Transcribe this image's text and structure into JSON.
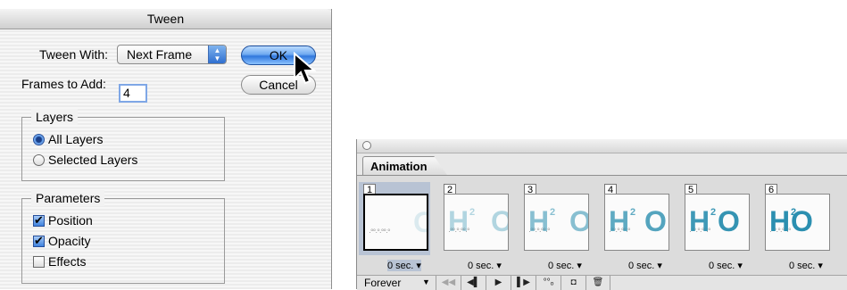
{
  "dialog": {
    "title": "Tween",
    "tween_with_label": "Tween With:",
    "tween_with_value": "Next Frame",
    "frames_to_add_label": "Frames to Add:",
    "frames_to_add_value": "4",
    "ok_label": "OK",
    "cancel_label": "Cancel",
    "layers_group": {
      "title": "Layers",
      "options": [
        {
          "label": "All Layers",
          "selected": true
        },
        {
          "label": "Selected Layers",
          "selected": false
        }
      ]
    },
    "parameters_group": {
      "title": "Parameters",
      "options": [
        {
          "label": "Position",
          "checked": true
        },
        {
          "label": "Opacity",
          "checked": true
        },
        {
          "label": "Effects",
          "checked": false
        }
      ]
    }
  },
  "palette": {
    "tab": "Animation",
    "frames": [
      {
        "number": "1",
        "delay": "0 sec.",
        "selected": true
      },
      {
        "number": "2",
        "delay": "0 sec.",
        "selected": false
      },
      {
        "number": "3",
        "delay": "0 sec.",
        "selected": false
      },
      {
        "number": "4",
        "delay": "0 sec.",
        "selected": false
      },
      {
        "number": "5",
        "delay": "0 sec.",
        "selected": false
      },
      {
        "number": "6",
        "delay": "0 sec.",
        "selected": false
      }
    ],
    "loop": "Forever",
    "thumb_text": {
      "h": "H",
      "two": "2",
      "o": "O"
    },
    "colors": {
      "accent": "#2b8fb0",
      "selected": "#b8c3d4"
    }
  }
}
